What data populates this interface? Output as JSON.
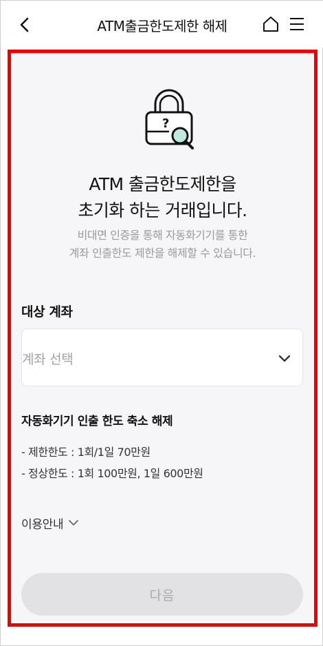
{
  "header": {
    "title": "ATM출금한도제한 해제"
  },
  "icons": {
    "back": "chevron-left-icon",
    "home": "home-icon",
    "menu": "hamburger-menu-icon",
    "lock": "lock-question-magnifier-icon",
    "select_chevron": "chevron-down-icon",
    "guide_chevron": "chevron-down-icon"
  },
  "intro": {
    "headline_line1": "ATM 출금한도제한을",
    "headline_line2": "초기화 하는 거래입니다.",
    "sub_line1": "비대면 인증을 통해 자동화기기를 통한",
    "sub_line2": "계좌 인출한도 제한을 해제할 수 있습니다."
  },
  "account": {
    "label": "대상 계좌",
    "placeholder": "계좌 선택"
  },
  "limits": {
    "title": "자동화기기 인출 한도 축소 해제",
    "line1": "- 제한한도 : 1회/1일 70만원",
    "line2": "- 정상한도 : 1회 100만원, 1일 600만원"
  },
  "guide": {
    "label": "이용안내"
  },
  "footer": {
    "next_label": "다음"
  },
  "colors": {
    "highlight_border": "#ec0000",
    "panel_background": "#f6f6f8",
    "disabled_button": "#e2e2e4",
    "lock_accent": "#bfe8df"
  }
}
